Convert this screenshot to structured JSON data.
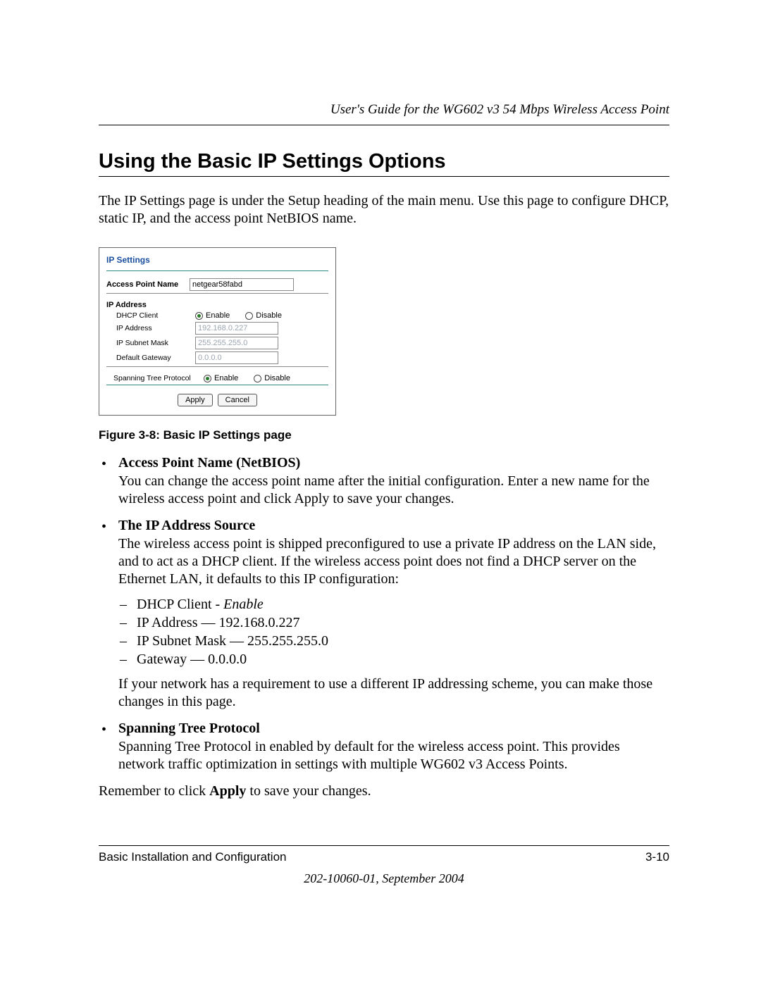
{
  "header": {
    "running_head": "User's Guide for the WG602 v3 54 Mbps Wireless Access Point"
  },
  "section": {
    "title": "Using the Basic IP Settings Options",
    "intro": "The IP Settings page is under the Setup heading of the main menu. Use this page to configure DHCP, static IP, and the access point NetBIOS name."
  },
  "screenshot": {
    "panel_title": "IP Settings",
    "ap_name_label": "Access Point Name",
    "ap_name_value": "netgear58fabd",
    "ip_section_label": "IP Address",
    "dhcp_label": "DHCP Client",
    "enable_label": "Enable",
    "disable_label": "Disable",
    "ip_address_label": "IP Address",
    "ip_address_value": "192.168.0.227",
    "subnet_label": "IP Subnet Mask",
    "subnet_value": "255.255.255.0",
    "gateway_label": "Default Gateway",
    "gateway_value": "0.0.0.0",
    "stp_label": "Spanning Tree Protocol",
    "apply_btn": "Apply",
    "cancel_btn": "Cancel"
  },
  "figure_caption": "Figure 3-8: Basic IP Settings page",
  "bullets": {
    "b1_title": "Access Point Name (NetBIOS)",
    "b1_body": "You can change the access point name after the initial configuration. Enter a new name for the wireless access point and click Apply to save your changes.",
    "b2_title": "The IP Address Source",
    "b2_body_a": "The wireless access point is shipped preconfigured to use a private IP address on the LAN side, and to act as a DHCP client. If the wireless access point does not find a DHCP server on the Ethernet LAN, it defaults to this IP configuration:",
    "b2_d1a": "DHCP Client - ",
    "b2_d1b": "Enable",
    "b2_d2": "IP Address — 192.168.0.227",
    "b2_d3": "IP Subnet Mask — 255.255.255.0",
    "b2_d4": "Gateway — 0.0.0.0",
    "b2_body_b": "If your network has a requirement to use a different IP addressing scheme, you can make those changes in this page.",
    "b3_title": "Spanning Tree Protocol",
    "b3_body": "Spanning Tree Protocol in enabled by default for the wireless access point. This provides network traffic optimization in settings with multiple WG602 v3 Access Points."
  },
  "closing": {
    "pre": "Remember to click ",
    "bold": "Apply",
    "post": " to save your changes."
  },
  "footer": {
    "left": "Basic Installation and Configuration",
    "right": "3-10",
    "pub": "202-10060-01, September 2004"
  }
}
